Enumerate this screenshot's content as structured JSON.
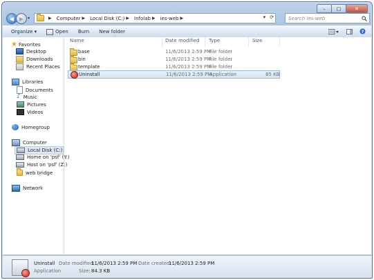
{
  "window": {
    "caption_buttons": [
      "minimize",
      "maximize",
      "close"
    ]
  },
  "nav": {
    "address_path": [
      "Computer",
      "Local Disk (C:)",
      "Infolab",
      "ies-web"
    ],
    "search_placeholder": "Search ies-web"
  },
  "toolbar": {
    "organize": "Organize ▾",
    "open": "Open",
    "burn": "Burn",
    "new_folder": "New folder"
  },
  "sidebar": {
    "favorites": {
      "label": "Favorites",
      "items": [
        "Desktop",
        "Downloads",
        "Recent Places"
      ]
    },
    "libraries": {
      "label": "Libraries",
      "items": [
        "Documents",
        "Music",
        "Pictures",
        "Videos"
      ]
    },
    "homegroup": "Homegroup",
    "computer": {
      "label": "Computer",
      "items": [
        "Local Disk (C:)",
        "Home on 'psf' (Y:)",
        "Host on 'psf' (Z:)",
        "web bridge"
      ]
    },
    "network": "Network"
  },
  "columns": {
    "name": "Name",
    "date": "Date modified",
    "type": "Type",
    "size": "Size"
  },
  "files": [
    {
      "name": "base",
      "date": "11/6/2013 2:59 PM",
      "type": "File folder",
      "size": "",
      "icon": "folder-icon",
      "selected": false
    },
    {
      "name": "bin",
      "date": "11/6/2013 2:59 PM",
      "type": "File folder",
      "size": "",
      "icon": "folder-icon",
      "selected": false
    },
    {
      "name": "template",
      "date": "11/6/2013 2:59 PM",
      "type": "File folder",
      "size": "",
      "icon": "folder-icon",
      "selected": false
    },
    {
      "name": "Uninstall",
      "date": "11/6/2013 2:59 PM",
      "type": "Application",
      "size": "85 KB",
      "icon": "application-icon",
      "selected": true
    }
  ],
  "details": {
    "name": "Uninstall",
    "type": "Application",
    "modified_label": "Date modified:",
    "modified_value": "11/6/2013 2:59 PM",
    "size_label": "Size:",
    "size_value": "84.3 KB",
    "created_label": "Date created:",
    "created_value": "11/6/2013 2:59 PM"
  },
  "colors": {
    "selection": "#d4e4f6",
    "chrome": "#b9cfe8"
  }
}
